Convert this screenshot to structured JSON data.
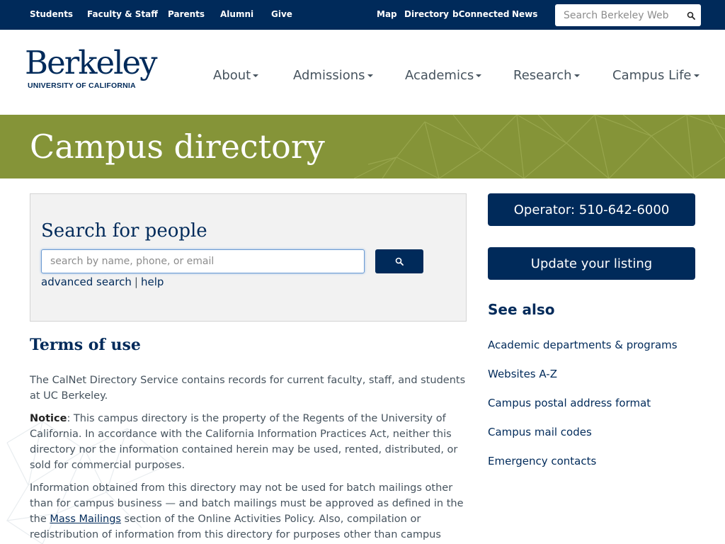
{
  "topbar": {
    "left_links": [
      "Students",
      "Faculty & Staff",
      "Parents",
      "Alumni",
      "Give"
    ],
    "right_links": [
      "Map",
      "Directory",
      "bConnected",
      "News"
    ],
    "search_placeholder": "Search Berkeley Web"
  },
  "logo": {
    "wordmark": "Berkeley",
    "subtitle": "UNIVERSITY OF CALIFORNIA"
  },
  "nav": {
    "items": [
      "About",
      "Admissions",
      "Academics",
      "Research",
      "Campus Life"
    ]
  },
  "banner": {
    "title": "Campus directory"
  },
  "search_panel": {
    "title": "Search for people",
    "placeholder": "search by name, phone, or email",
    "advanced_label": "advanced search",
    "separator": "|",
    "help_label": "help"
  },
  "terms": {
    "title": "Terms of use",
    "p1": "The CalNet Directory Service contains records for current faculty, staff, and students at UC Berkeley.",
    "notice_label": "Notice",
    "notice_text": ": This campus directory is the property of the Regents of the University of California. In accordance with the California Information Practices Act, neither this directory nor the information contained herein may be used, rented, distributed, or sold for commercial purposes.",
    "p3_before": "Information obtained from this directory may not be used for batch mailings other than for campus business — and batch mailings must be approved as defined in the the ",
    "p3_link": "Mass Mailings",
    "p3_after": " section of the Online Activities Policy. Also, compilation or redistribution of information from this directory for purposes other than campus business is strictly"
  },
  "sidebar": {
    "operator_label": "Operator: 510-642-6000",
    "update_label": "Update your listing",
    "see_also_title": "See also",
    "links": [
      "Academic departments & programs",
      "Websites A-Z",
      "Campus postal address format",
      "Campus mail codes",
      "Emergency contacts"
    ]
  },
  "colors": {
    "berkeley_blue": "#002a5a",
    "banner_green": "#859438",
    "panel_gray": "#f2f2f2",
    "text_gray": "#46535e"
  }
}
